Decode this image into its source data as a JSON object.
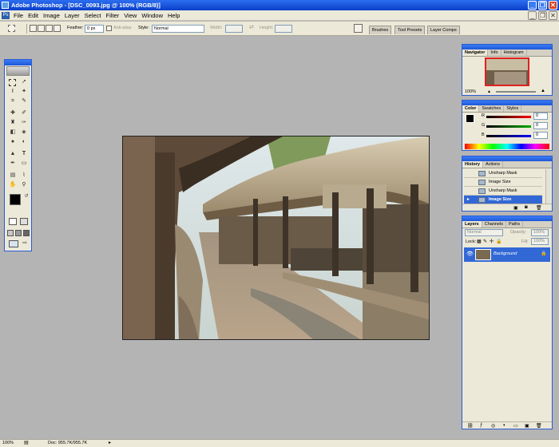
{
  "window": {
    "title": "Adobe Photoshop - [DSC_0093.jpg @ 100% (RGB/8)]",
    "minimize": "_",
    "restore": "❐",
    "close": "✕"
  },
  "menu": [
    "File",
    "Edit",
    "Image",
    "Layer",
    "Select",
    "Filter",
    "View",
    "Window",
    "Help"
  ],
  "options": {
    "feather_label": "Feather:",
    "feather_value": "0 px",
    "antialias_label": "Anti-alias",
    "style_label": "Style:",
    "style_value": "Normal",
    "width_label": "Width:",
    "height_label": "Height:",
    "palette_well_tabs": [
      "Brushes",
      "Tool Presets",
      "Layer Comps"
    ]
  },
  "navigator": {
    "tabs": [
      "Navigator",
      "Info",
      "Histogram"
    ],
    "zoom": "100%"
  },
  "color": {
    "tabs": [
      "Color",
      "Swatches",
      "Styles"
    ],
    "r_label": "R",
    "g_label": "G",
    "b_label": "B",
    "r_value": "0",
    "g_value": "0",
    "b_value": "0"
  },
  "history": {
    "tabs": [
      "History",
      "Actions"
    ],
    "items": [
      "Unsharp Mask",
      "Image Size",
      "Unsharp Mask",
      "Image Size"
    ],
    "selected_index": 3
  },
  "layers": {
    "tabs": [
      "Layers",
      "Channels",
      "Paths"
    ],
    "blend_mode": "Normal",
    "opacity_label": "Opacity:",
    "opacity_value": "100%",
    "lock_label": "Lock:",
    "fill_label": "Fill:",
    "fill_value": "100%",
    "layer_name": "Background"
  },
  "status": {
    "zoom": "100%",
    "doc": "Doc: 955.7K/955.7K"
  },
  "colors": {
    "title_bar": "#0a3fc8",
    "selection": "#3168d5",
    "workspace": "#b4b4b4"
  }
}
